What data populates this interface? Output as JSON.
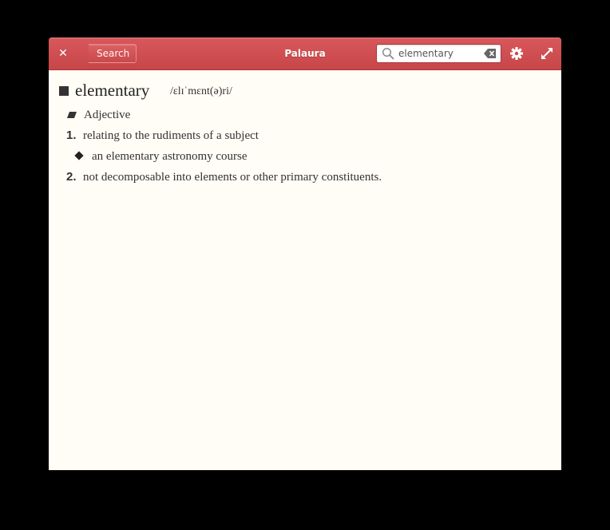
{
  "window": {
    "title": "Palaura"
  },
  "header": {
    "back_label": "Search",
    "search": {
      "value": "elementary",
      "placeholder": ""
    }
  },
  "icons": {
    "close": "close-icon",
    "search": "search-icon",
    "clear": "clear-icon",
    "settings": "gear-icon",
    "fullscreen": "fullscreen-icon"
  },
  "colors": {
    "headerbar": "#c64649",
    "content_bg": "#fffdf5",
    "text": "#333333"
  },
  "entry": {
    "word": "elementary",
    "phonetic": "/ɛlɪˈmɛnt(ə)ri/",
    "part_of_speech": "Adjective",
    "definitions": [
      {
        "number": "1.",
        "text": "relating to the rudiments of a subject",
        "example": "an elementary astronomy course"
      },
      {
        "number": "2.",
        "text": "not decomposable into elements or other primary constituents."
      }
    ]
  }
}
